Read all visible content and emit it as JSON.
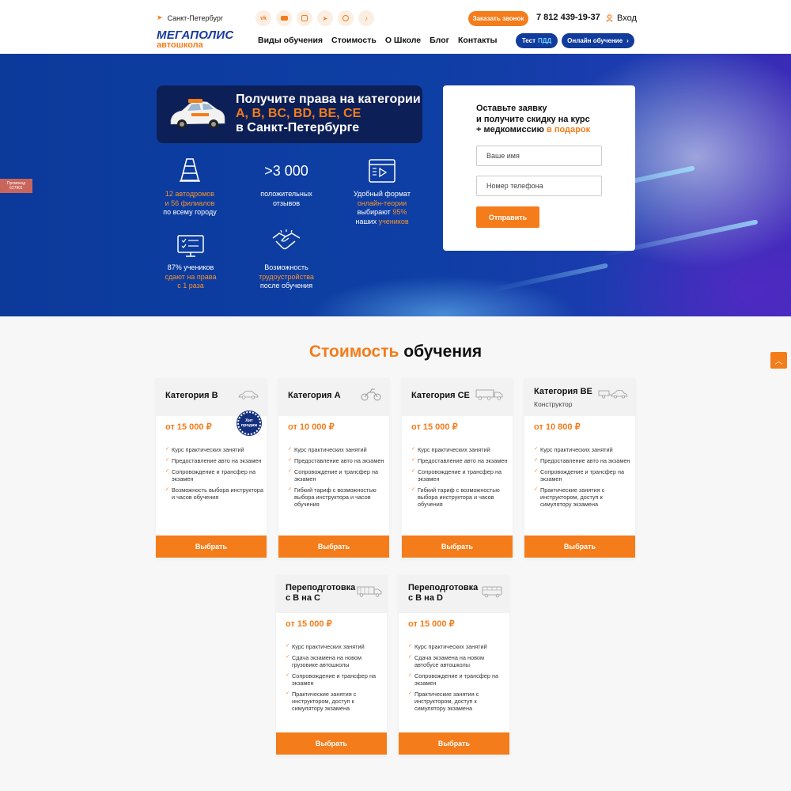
{
  "header": {
    "city": "Санкт-Петербург",
    "socials": [
      {
        "icon": "vk-icon",
        "color": "#f47c1a"
      },
      {
        "icon": "youtube-icon",
        "color": "#f47c1a"
      },
      {
        "icon": "instagram-icon",
        "color": "#f47c1a"
      },
      {
        "icon": "telegram-icon",
        "color": "#f47c1a"
      },
      {
        "icon": "whatsapp-icon",
        "color": "#f47c1a"
      },
      {
        "icon": "tiktok-icon",
        "color": "#f47c1a"
      }
    ],
    "callback_button": "Заказать звонок",
    "phone": "7 812 439-19-37",
    "login": "Вход",
    "logo_line1": "МЕГАПОЛИС",
    "logo_line2": "автошкола",
    "nav": [
      "Виды обучения",
      "Стоимость",
      "О Школе",
      "Блог",
      "Контакты"
    ],
    "test_button_a": "Тест",
    "test_button_b": "ПДД",
    "online_button": "Онлайн обучение"
  },
  "promo_tab": {
    "line1": "Промокод",
    "line2": "527901"
  },
  "hero": {
    "title_line1": "Получите права на категории",
    "title_line2": "A, B, BC, BD, BE, CE",
    "title_line3": "в Санкт-Петербурге",
    "features": [
      {
        "icon": "traffic-cone-icon",
        "a": "12 автодромов",
        "b": "и 56 филиалов",
        "c": "по всему городу"
      },
      {
        "big": ">3 000",
        "a": "положительных",
        "b": "отзывов"
      },
      {
        "icon": "video-player-icon",
        "a": "Удобный формат",
        "b": "онлайн-теории",
        "c": "выбирают",
        "d": "95%",
        "e": "наших",
        "f": "учеников"
      },
      {
        "icon": "checklist-monitor-icon",
        "a": "87% учеников",
        "b": "сдают на права",
        "c": "с 1 раза"
      },
      {
        "icon": "handshake-icon",
        "a": "Возможность",
        "b": "трудоустройства",
        "c": "после обучения"
      }
    ]
  },
  "form": {
    "title_line1": "Оставьте заявку",
    "title_line2": "и получите скидку на курс",
    "title_line3": "+ медкомиссию",
    "title_gift": "в подарок",
    "name_placeholder": "Ваше имя",
    "phone_placeholder": "Номер телефона",
    "submit": "Отправить"
  },
  "pricing": {
    "title_orange": "Стоимость",
    "title_black": "обучения",
    "badge": "Хит продаж",
    "select_label": "Выбрать",
    "cards": [
      {
        "name": "Категория B",
        "icon": "car-icon",
        "price": "от 15 000 ₽",
        "features": [
          "Курс практических занятий",
          "Предоставление авто на экзамен",
          "Сопровождение и трансфер на экзамен",
          "Возможность выбора инструктора и часов обучения"
        ]
      },
      {
        "name": "Категория A",
        "icon": "motorcycle-icon",
        "price": "от 10 000 ₽",
        "features": [
          "Курс практических занятий",
          "Предоставление авто на экзамен",
          "Сопровождение и трансфер на экзамен",
          "Гибкий тариф с возможностью выбора инструктора и часов обучения"
        ]
      },
      {
        "name": "Категория CE",
        "icon": "truck-trailer-icon",
        "price": "от 15 000 ₽",
        "features": [
          "Курс практических занятий",
          "Предоставление авто на экзамен",
          "Сопровождение и трансфер на экзамен",
          "Гибкий тариф с возможностью выбора инструктора и часов обучения"
        ]
      },
      {
        "name": "Категория BE",
        "sub": "Конструктор",
        "icon": "car-trailer-icon",
        "price": "от 10 800 ₽",
        "features": [
          "Курс практических занятий",
          "Предоставление авто на экзамен",
          "Сопровождение и трансфер на экзамен",
          "Практические занятия с инструктором, доступ к симулятору экзамена"
        ]
      },
      {
        "name_line1": "Переподготовка",
        "name_line2": "с B на C",
        "icon": "truck-icon",
        "price": "от 15 000 ₽",
        "features": [
          "Курс практических занятий",
          "Сдача экзамена на новом грузовике автошколы",
          "Сопровождение и трансфер на экзамен",
          "Практические занятия с инструктором, доступ к симулятору экзамена"
        ]
      },
      {
        "name_line1": "Переподготовка",
        "name_line2": "с B на D",
        "icon": "bus-icon",
        "price": "от 15 000 ₽",
        "features": [
          "Курс практических занятий",
          "Сдача экзамена на новом автобусе автошколы",
          "Сопровождение и трансфер на экзамен",
          "Практические занятия с инструктором, доступ к симулятору экзамена"
        ]
      }
    ]
  },
  "colors": {
    "accent": "#f47c1a",
    "brand_blue": "#123c9c"
  }
}
